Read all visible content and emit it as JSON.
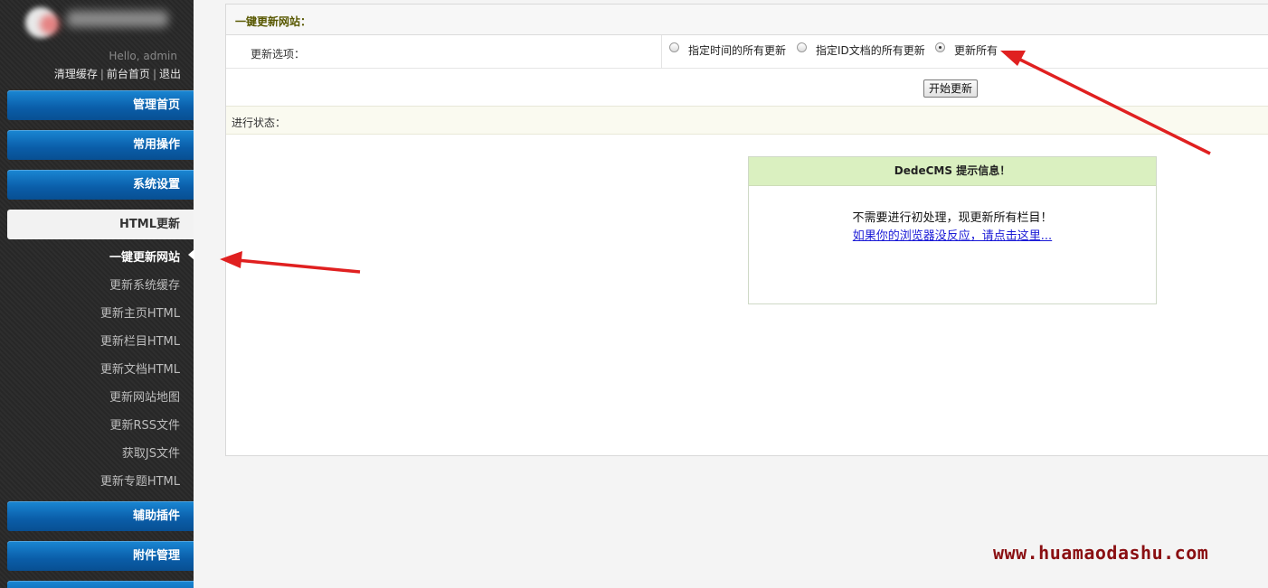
{
  "sidebar": {
    "hello": "Hello, admin",
    "quick_links": [
      "清理缓存",
      "前台首页",
      "退出"
    ],
    "sections_top": [
      "管理首页",
      "常用操作",
      "系统设置"
    ],
    "active_section": "HTML更新",
    "sub_items": [
      "一键更新网站",
      "更新系统缓存",
      "更新主页HTML",
      "更新栏目HTML",
      "更新文档HTML",
      "更新网站地图",
      "更新RSS文件",
      "获取JS文件",
      "更新专题HTML"
    ],
    "sections_bottom": [
      "辅助插件",
      "附件管理"
    ]
  },
  "main": {
    "title": "一键更新网站：",
    "option_label": "更新选项：",
    "radio_options": [
      {
        "label": "指定时间的所有更新",
        "checked": false
      },
      {
        "label": "指定ID文档的所有更新",
        "checked": false
      },
      {
        "label": "更新所有",
        "checked": true
      }
    ],
    "start_button": "开始更新",
    "status_label": "进行状态：",
    "message": {
      "title": "DedeCMS 提示信息！",
      "text": "不需要进行初处理，现更新所有栏目！",
      "link": "如果你的浏览器没反应，请点击这里..."
    }
  },
  "watermark": "www.huamaodashu.com",
  "colors": {
    "menu_blue": "#0a5da8",
    "message_header": "#daf0c0",
    "annotation_arrow": "#e02020",
    "watermark": "#8a0f12"
  }
}
